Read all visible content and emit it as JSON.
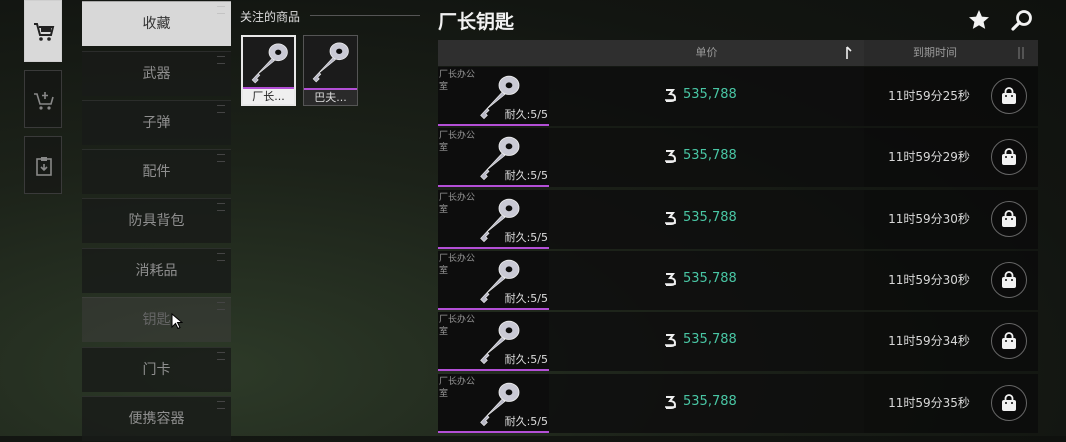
{
  "rail": [
    {
      "icon": "shopping-cart-icon",
      "active": true
    },
    {
      "icon": "cart-add-icon",
      "active": false
    },
    {
      "icon": "clipboard-icon",
      "active": false
    }
  ],
  "categories": [
    {
      "label": "收藏",
      "state": "selected"
    },
    {
      "label": "武器",
      "state": "normal"
    },
    {
      "label": "子弹",
      "state": "normal"
    },
    {
      "label": "配件",
      "state": "normal"
    },
    {
      "label": "防具背包",
      "state": "normal"
    },
    {
      "label": "消耗品",
      "state": "normal"
    },
    {
      "label": "钥匙",
      "state": "hover"
    },
    {
      "label": "门卡",
      "state": "normal"
    },
    {
      "label": "便携容器",
      "state": "normal"
    }
  ],
  "favorites": {
    "title": "关注的商品",
    "items": [
      {
        "name": "厂长...",
        "selected": true
      },
      {
        "name": "巴夫...",
        "selected": false
      }
    ]
  },
  "item_title": "厂长钥匙",
  "header_icons": [
    "star-icon",
    "search-icon"
  ],
  "table": {
    "col_price": "单价",
    "col_expire": "到期时间",
    "rows": [
      {
        "location": "厂长办公室",
        "durability": "耐久:5/5",
        "price": "535,788",
        "expire": "11时59分25秒"
      },
      {
        "location": "厂长办公室",
        "durability": "耐久:5/5",
        "price": "535,788",
        "expire": "11时59分29秒"
      },
      {
        "location": "厂长办公室",
        "durability": "耐久:5/5",
        "price": "535,788",
        "expire": "11时59分30秒"
      },
      {
        "location": "厂长办公室",
        "durability": "耐久:5/5",
        "price": "535,788",
        "expire": "11时59分30秒"
      },
      {
        "location": "厂长办公室",
        "durability": "耐久:5/5",
        "price": "535,788",
        "expire": "11时59分34秒"
      },
      {
        "location": "厂长办公室",
        "durability": "耐久:5/5",
        "price": "535,788",
        "expire": "11时59分35秒"
      }
    ]
  },
  "colors": {
    "price": "#49c6a4",
    "rarity": "#b34fd6",
    "selected_bg": "#d8d8d8"
  }
}
